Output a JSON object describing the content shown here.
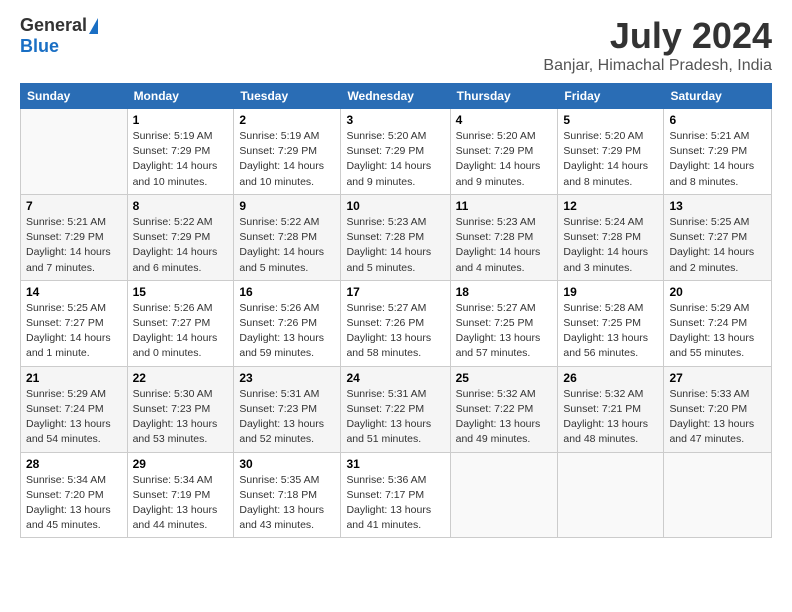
{
  "header": {
    "logo_general": "General",
    "logo_blue": "Blue",
    "title": "July 2024",
    "location": "Banjar, Himachal Pradesh, India"
  },
  "weekdays": [
    "Sunday",
    "Monday",
    "Tuesday",
    "Wednesday",
    "Thursday",
    "Friday",
    "Saturday"
  ],
  "weeks": [
    [
      {
        "day": "",
        "info": ""
      },
      {
        "day": "1",
        "info": "Sunrise: 5:19 AM\nSunset: 7:29 PM\nDaylight: 14 hours\nand 10 minutes."
      },
      {
        "day": "2",
        "info": "Sunrise: 5:19 AM\nSunset: 7:29 PM\nDaylight: 14 hours\nand 10 minutes."
      },
      {
        "day": "3",
        "info": "Sunrise: 5:20 AM\nSunset: 7:29 PM\nDaylight: 14 hours\nand 9 minutes."
      },
      {
        "day": "4",
        "info": "Sunrise: 5:20 AM\nSunset: 7:29 PM\nDaylight: 14 hours\nand 9 minutes."
      },
      {
        "day": "5",
        "info": "Sunrise: 5:20 AM\nSunset: 7:29 PM\nDaylight: 14 hours\nand 8 minutes."
      },
      {
        "day": "6",
        "info": "Sunrise: 5:21 AM\nSunset: 7:29 PM\nDaylight: 14 hours\nand 8 minutes."
      }
    ],
    [
      {
        "day": "7",
        "info": "Sunrise: 5:21 AM\nSunset: 7:29 PM\nDaylight: 14 hours\nand 7 minutes."
      },
      {
        "day": "8",
        "info": "Sunrise: 5:22 AM\nSunset: 7:29 PM\nDaylight: 14 hours\nand 6 minutes."
      },
      {
        "day": "9",
        "info": "Sunrise: 5:22 AM\nSunset: 7:28 PM\nDaylight: 14 hours\nand 5 minutes."
      },
      {
        "day": "10",
        "info": "Sunrise: 5:23 AM\nSunset: 7:28 PM\nDaylight: 14 hours\nand 5 minutes."
      },
      {
        "day": "11",
        "info": "Sunrise: 5:23 AM\nSunset: 7:28 PM\nDaylight: 14 hours\nand 4 minutes."
      },
      {
        "day": "12",
        "info": "Sunrise: 5:24 AM\nSunset: 7:28 PM\nDaylight: 14 hours\nand 3 minutes."
      },
      {
        "day": "13",
        "info": "Sunrise: 5:25 AM\nSunset: 7:27 PM\nDaylight: 14 hours\nand 2 minutes."
      }
    ],
    [
      {
        "day": "14",
        "info": "Sunrise: 5:25 AM\nSunset: 7:27 PM\nDaylight: 14 hours\nand 1 minute."
      },
      {
        "day": "15",
        "info": "Sunrise: 5:26 AM\nSunset: 7:27 PM\nDaylight: 14 hours\nand 0 minutes."
      },
      {
        "day": "16",
        "info": "Sunrise: 5:26 AM\nSunset: 7:26 PM\nDaylight: 13 hours\nand 59 minutes."
      },
      {
        "day": "17",
        "info": "Sunrise: 5:27 AM\nSunset: 7:26 PM\nDaylight: 13 hours\nand 58 minutes."
      },
      {
        "day": "18",
        "info": "Sunrise: 5:27 AM\nSunset: 7:25 PM\nDaylight: 13 hours\nand 57 minutes."
      },
      {
        "day": "19",
        "info": "Sunrise: 5:28 AM\nSunset: 7:25 PM\nDaylight: 13 hours\nand 56 minutes."
      },
      {
        "day": "20",
        "info": "Sunrise: 5:29 AM\nSunset: 7:24 PM\nDaylight: 13 hours\nand 55 minutes."
      }
    ],
    [
      {
        "day": "21",
        "info": "Sunrise: 5:29 AM\nSunset: 7:24 PM\nDaylight: 13 hours\nand 54 minutes."
      },
      {
        "day": "22",
        "info": "Sunrise: 5:30 AM\nSunset: 7:23 PM\nDaylight: 13 hours\nand 53 minutes."
      },
      {
        "day": "23",
        "info": "Sunrise: 5:31 AM\nSunset: 7:23 PM\nDaylight: 13 hours\nand 52 minutes."
      },
      {
        "day": "24",
        "info": "Sunrise: 5:31 AM\nSunset: 7:22 PM\nDaylight: 13 hours\nand 51 minutes."
      },
      {
        "day": "25",
        "info": "Sunrise: 5:32 AM\nSunset: 7:22 PM\nDaylight: 13 hours\nand 49 minutes."
      },
      {
        "day": "26",
        "info": "Sunrise: 5:32 AM\nSunset: 7:21 PM\nDaylight: 13 hours\nand 48 minutes."
      },
      {
        "day": "27",
        "info": "Sunrise: 5:33 AM\nSunset: 7:20 PM\nDaylight: 13 hours\nand 47 minutes."
      }
    ],
    [
      {
        "day": "28",
        "info": "Sunrise: 5:34 AM\nSunset: 7:20 PM\nDaylight: 13 hours\nand 45 minutes."
      },
      {
        "day": "29",
        "info": "Sunrise: 5:34 AM\nSunset: 7:19 PM\nDaylight: 13 hours\nand 44 minutes."
      },
      {
        "day": "30",
        "info": "Sunrise: 5:35 AM\nSunset: 7:18 PM\nDaylight: 13 hours\nand 43 minutes."
      },
      {
        "day": "31",
        "info": "Sunrise: 5:36 AM\nSunset: 7:17 PM\nDaylight: 13 hours\nand 41 minutes."
      },
      {
        "day": "",
        "info": ""
      },
      {
        "day": "",
        "info": ""
      },
      {
        "day": "",
        "info": ""
      }
    ]
  ]
}
